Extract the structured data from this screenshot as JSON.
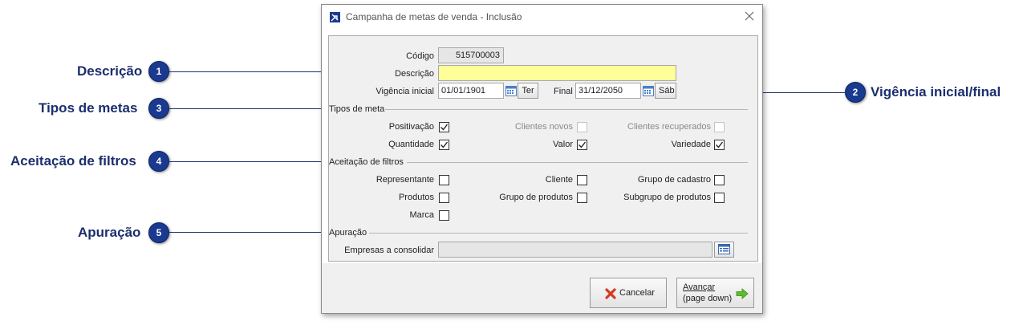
{
  "annotations": [
    {
      "number": "1",
      "label": "Descrição"
    },
    {
      "number": "2",
      "label": "Vigência inicial/final"
    },
    {
      "number": "3",
      "label": "Tipos de metas"
    },
    {
      "number": "4",
      "label": "Aceitação de filtros"
    },
    {
      "number": "5",
      "label": "Apuração"
    }
  ],
  "window": {
    "title": "Campanha de metas de venda - Inclusão"
  },
  "form": {
    "codigo": {
      "label": "Código",
      "value": "515700003"
    },
    "descricao": {
      "label": "Descrição",
      "value": ""
    },
    "vigencia": {
      "label_inicial": "Vigência inicial",
      "inicial": "01/01/1901",
      "dia_inicial": "Ter",
      "label_final": "Final",
      "final": "31/12/2050",
      "dia_final": "Sáb"
    },
    "tipos_de_meta": {
      "title": "Tipos de meta",
      "items": [
        {
          "label": "Positivação",
          "checked": true,
          "enabled": true
        },
        {
          "label": "Clientes novos",
          "checked": false,
          "enabled": false
        },
        {
          "label": "Clientes recuperados",
          "checked": false,
          "enabled": false
        },
        {
          "label": "Quantidade",
          "checked": true,
          "enabled": true
        },
        {
          "label": "Valor",
          "checked": true,
          "enabled": true
        },
        {
          "label": "Variedade",
          "checked": true,
          "enabled": true
        }
      ]
    },
    "aceitacao_filtros": {
      "title": "Aceitação de filtros",
      "items": [
        {
          "label": "Representante",
          "checked": false
        },
        {
          "label": "Cliente",
          "checked": false
        },
        {
          "label": "Grupo de cadastro",
          "checked": false
        },
        {
          "label": "Produtos",
          "checked": false
        },
        {
          "label": "Grupo de produtos",
          "checked": false
        },
        {
          "label": "Subgrupo de produtos",
          "checked": false
        },
        {
          "label": "Marca",
          "checked": false
        }
      ]
    },
    "apuracao": {
      "title": "Apuração",
      "empresas_label": "Empresas a consolidar",
      "empresas_value": ""
    }
  },
  "buttons": {
    "cancel": "Cancelar",
    "advance_line1": "Avançar",
    "advance_line2": "(page down)"
  },
  "colors": {
    "annotation_badge": "#1a3a8f",
    "annotation_text": "#1b2f6e",
    "description_field": "#ffff99"
  }
}
